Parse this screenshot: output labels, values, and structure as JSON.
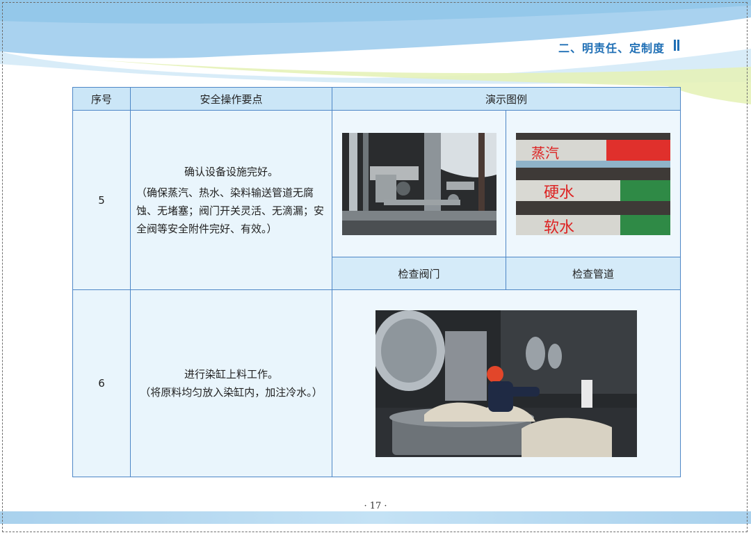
{
  "header": {
    "section_title": "二、明责任、定制度"
  },
  "table": {
    "headers": [
      "序号",
      "安全操作要点",
      "演示图例"
    ],
    "rows": [
      {
        "number": "5",
        "title": "确认设备设施完好。",
        "detail": "（确保蒸汽、热水、染料输送管道无腐蚀、无堵塞；阀门开关灵活、无滴漏；安全阀等安全附件完好、有效。）",
        "captions": [
          "检查阀门",
          "检查管道"
        ],
        "pipe_labels": [
          "蒸汽",
          "硬水",
          "软水"
        ]
      },
      {
        "number": "6",
        "title": "进行染缸上料工作。",
        "detail": "（将原料均匀放入染缸内，加注冷水。）"
      }
    ]
  },
  "footer": {
    "page_number": "· 17 ·"
  },
  "colors": {
    "border": "#4d86c6",
    "header_fill": "#cbe6f7",
    "title": "#1f6fb5"
  }
}
